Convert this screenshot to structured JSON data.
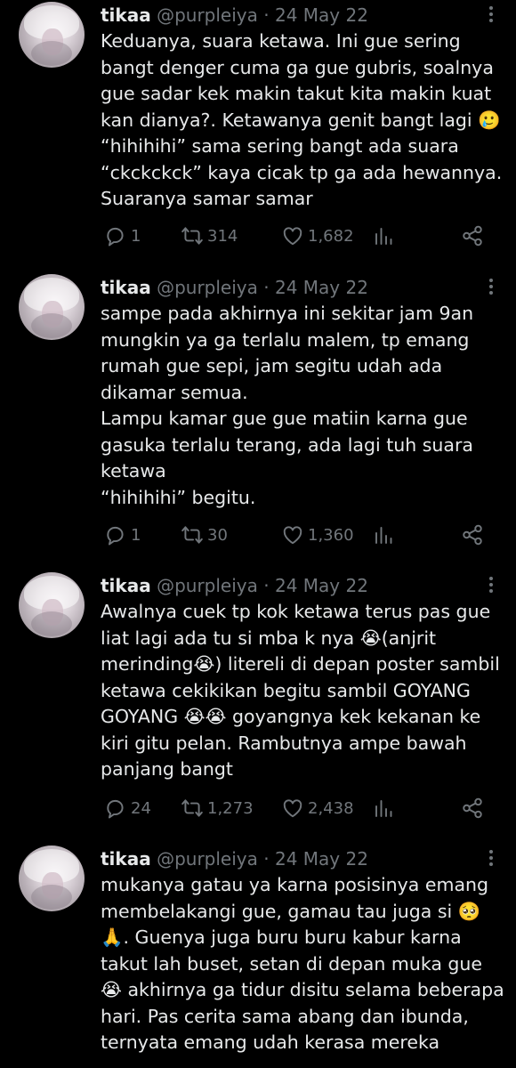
{
  "tweets": [
    {
      "display_name": "tikaa",
      "handle": "@purpleiya",
      "separator": "·",
      "date": "24 May 22",
      "text": "Keduanya, suara ketawa. Ini gue sering bangt denger cuma ga gue gubris, soalnya gue sadar kek makin takut kita makin kuat kan dianya?. Ketawanya genit bangt lagi 🥲 “hihihihi” sama sering bangt ada suara “ckckckck” kaya cicak tp ga ada hewannya. Suaranya samar samar",
      "replies": "1",
      "retweets": "314",
      "likes": "1,682"
    },
    {
      "display_name": "tikaa",
      "handle": "@purpleiya",
      "separator": "·",
      "date": "24 May 22",
      "text": "sampe pada akhirnya ini sekitar  jam 9an mungkin ya ga terlalu malem, tp emang rumah gue sepi, jam segitu udah ada dikamar semua.\nLampu kamar gue gue matiin karna gue gasuka terlalu terang, ada lagi tuh suara ketawa\n“hihihihi” begitu.",
      "replies": "1",
      "retweets": "30",
      "likes": "1,360"
    },
    {
      "display_name": "tikaa",
      "handle": "@purpleiya",
      "separator": "·",
      "date": "24 May 22",
      "text": "Awalnya cuek tp kok ketawa terus pas gue liat lagi ada tu si mba k nya 😭(anjrit merinding😭)  litereli di depan poster sambil ketawa cekikikan begitu sambil GOYANG GOYANG 😭😭 goyangnya kek kekanan ke kiri gitu pelan. Rambutnya ampe bawah panjang bangt",
      "replies": "24",
      "retweets": "1,273",
      "likes": "2,438"
    },
    {
      "display_name": "tikaa",
      "handle": "@purpleiya",
      "separator": "·",
      "date": "24 May 22",
      "text": "mukanya gatau ya karna posisinya emang membelakangi gue, gamau tau juga si 🥺🙏. Guenya juga buru buru kabur karna takut lah buset, setan di depan muka gue 😭 akhirnya ga tidur disitu selama beberapa hari. Pas cerita sama abang dan ibunda, ternyata emang udah kerasa mereka",
      "replies": null,
      "retweets": null,
      "likes": null
    }
  ],
  "icons": {
    "reply": "reply-icon",
    "retweet": "retweet-icon",
    "like": "like-icon",
    "views": "views-icon",
    "share": "share-icon",
    "more": "more-icon"
  },
  "colors": {
    "background": "#000000",
    "text": "#e7e9ea",
    "muted": "#71767b"
  }
}
